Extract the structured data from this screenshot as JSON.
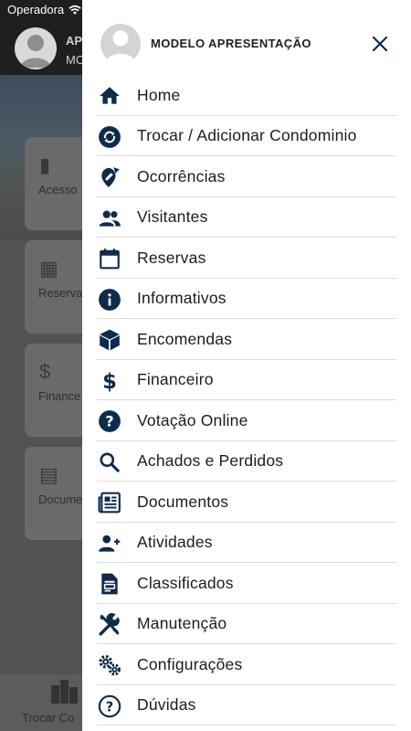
{
  "status_bar": {
    "carrier": "Operadora"
  },
  "background": {
    "header": {
      "line1": "AP",
      "line2": "MO"
    },
    "cards": [
      {
        "label": "Acesso",
        "icon": "door-icon"
      },
      {
        "label": "Reservas",
        "icon": "calendar-icon"
      },
      {
        "label": "Finance",
        "icon": "dollar-icon"
      },
      {
        "label": "Documen",
        "icon": "newspaper-icon"
      }
    ],
    "bottom_tab": {
      "label": "Trocar Co",
      "icon": "buildings-icon"
    }
  },
  "drawer": {
    "user_name": "MODELO APRESENTAÇÃO",
    "accent_color": "#0f2b4c",
    "items": [
      {
        "label": "Home",
        "icon": "home-icon"
      },
      {
        "label": "Trocar / Adicionar Condominio",
        "icon": "swap-icon"
      },
      {
        "label": "Ocorrências",
        "icon": "pin-edit-icon"
      },
      {
        "label": "Visitantes",
        "icon": "people-icon"
      },
      {
        "label": "Reservas",
        "icon": "calendar-icon"
      },
      {
        "label": "Informativos",
        "icon": "info-icon"
      },
      {
        "label": "Encomendas",
        "icon": "package-icon"
      },
      {
        "label": "Financeiro",
        "icon": "dollar-icon"
      },
      {
        "label": "Votação Online",
        "icon": "question-icon"
      },
      {
        "label": "Achados e Perdidos",
        "icon": "search-icon"
      },
      {
        "label": "Documentos",
        "icon": "newspaper-icon"
      },
      {
        "label": "Atividades",
        "icon": "person-add-icon"
      },
      {
        "label": "Classificados",
        "icon": "document-icon"
      },
      {
        "label": "Manutenção",
        "icon": "tools-icon"
      },
      {
        "label": "Configurações",
        "icon": "gears-icon"
      },
      {
        "label": "Dúvidas",
        "icon": "help-outline-icon"
      }
    ]
  }
}
